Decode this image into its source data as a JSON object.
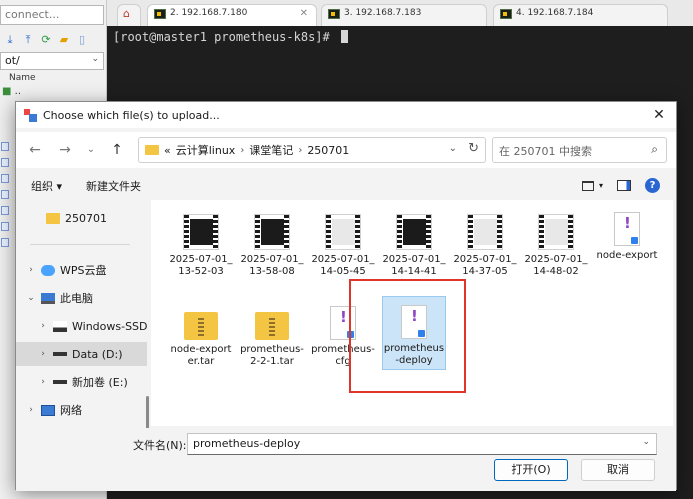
{
  "background_app": {
    "connect_placeholder": "connect...",
    "left_path": "ot/",
    "column_name": "Name",
    "tree_first": "..",
    "tabs": [
      {
        "label": "2. 192.168.7.180",
        "active": true
      },
      {
        "label": "3. 192.168.7.183",
        "active": false
      },
      {
        "label": "4. 192.168.7.184",
        "active": false
      }
    ],
    "terminal_prompt": "[root@master1 prometheus-k8s]# "
  },
  "dialog": {
    "title": "Choose which file(s) to upload...",
    "breadcrumb": {
      "overflow": "«",
      "crumbs": [
        "云计算linux",
        "课堂笔记",
        "250701"
      ]
    },
    "search_placeholder": "在 250701 中搜索",
    "toolbar": {
      "organize": "组织 ▾",
      "new_folder": "新建文件夹"
    },
    "nav_pane": {
      "current_folder": "250701",
      "items": [
        {
          "label": "WPS云盘",
          "chevron": "›"
        },
        {
          "label": "此电脑",
          "chevron": "⌄"
        },
        {
          "label": "Windows-SSD",
          "chevron": "›"
        },
        {
          "label": "Data (D:)",
          "chevron": "›"
        },
        {
          "label": "新加卷 (E:)",
          "chevron": "›"
        },
        {
          "label": "网络",
          "chevron": "›"
        }
      ]
    },
    "files": [
      {
        "name": "2025-07-01_13-52-03",
        "kind": "video"
      },
      {
        "name": "2025-07-01_13-58-08",
        "kind": "video"
      },
      {
        "name": "2025-07-01_14-05-45",
        "kind": "video"
      },
      {
        "name": "2025-07-01_14-14-41",
        "kind": "video"
      },
      {
        "name": "2025-07-01_14-37-05",
        "kind": "video"
      },
      {
        "name": "2025-07-01_14-48-02",
        "kind": "video"
      },
      {
        "name": "node-export",
        "kind": "doc"
      },
      {
        "name": "node-exporter.tar",
        "kind": "zip"
      },
      {
        "name": "prometheus-2-2-1.tar",
        "kind": "zip"
      },
      {
        "name": "prometheus-cfg",
        "kind": "doc"
      },
      {
        "name": "prometheus-deploy",
        "kind": "doc",
        "selected": true
      }
    ],
    "filename_label": "文件名(N):",
    "filename_value": "prometheus-deploy",
    "open_label": "打开(O)",
    "cancel_label": "取消"
  },
  "colors": {
    "accent": "#0067c0",
    "highlight_box": "#e0352b",
    "selection": "#cce4f7"
  }
}
